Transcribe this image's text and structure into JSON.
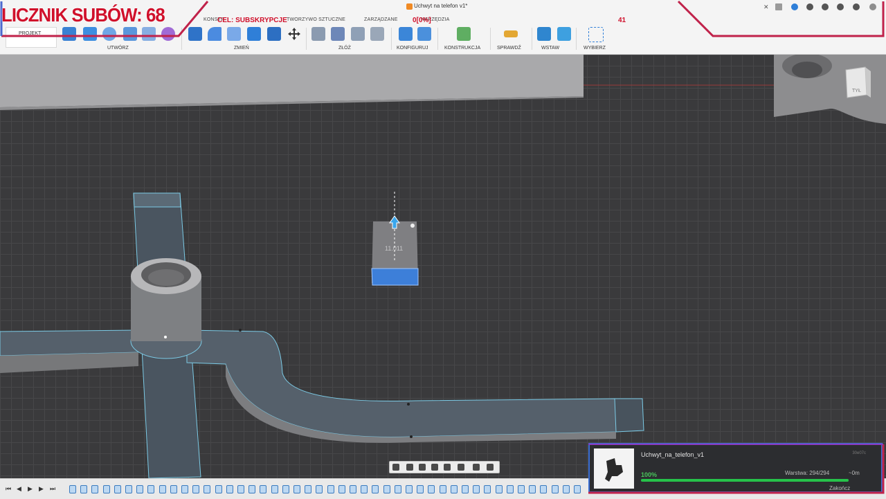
{
  "window": {
    "title": "Uchwyt na telefon v1*"
  },
  "ribbon": {
    "tabs": [
      "KONSTR",
      "TWORZYWO SZTUCZNE",
      "ZARZĄDZANE",
      "NARZĘDZIA"
    ],
    "workspace": "PROJEKT",
    "groups": [
      "UTWÓRZ",
      "ZMIEŃ",
      "ZŁÓŻ",
      "KONFIGURUJ",
      "KONSTRUKCJA",
      "SPRAWDŹ",
      "WSTAW",
      "WYBIERZ"
    ]
  },
  "overlay": {
    "counter": "LICZNIK SUBÓW: 68",
    "goal_label": "CEL: SUBSKRYPCJE",
    "goal_percent": "0[0%]",
    "goal_value": "41"
  },
  "viewport": {
    "dimension_label": "11.011",
    "viewcube_label": "TYŁ"
  },
  "print_card": {
    "file_name": "Uchwyt_na_telefon_v1",
    "job_id": "30e07c",
    "progress_label": "100%",
    "progress_value": 1.0,
    "layer": "Warstwa: 294/294",
    "time_left": "~0m",
    "status": "Zakończ"
  },
  "colors": {
    "accent": "#3b7bbf",
    "selection_face": "#3d7fd9",
    "overlay_red": "#d0102b",
    "progress_green": "#26c24a"
  },
  "icons": [
    "orange-document-icon",
    "search-icon",
    "help-icon",
    "notifications-icon",
    "user-avatar-icon",
    "close-icon",
    "plus-icon"
  ]
}
